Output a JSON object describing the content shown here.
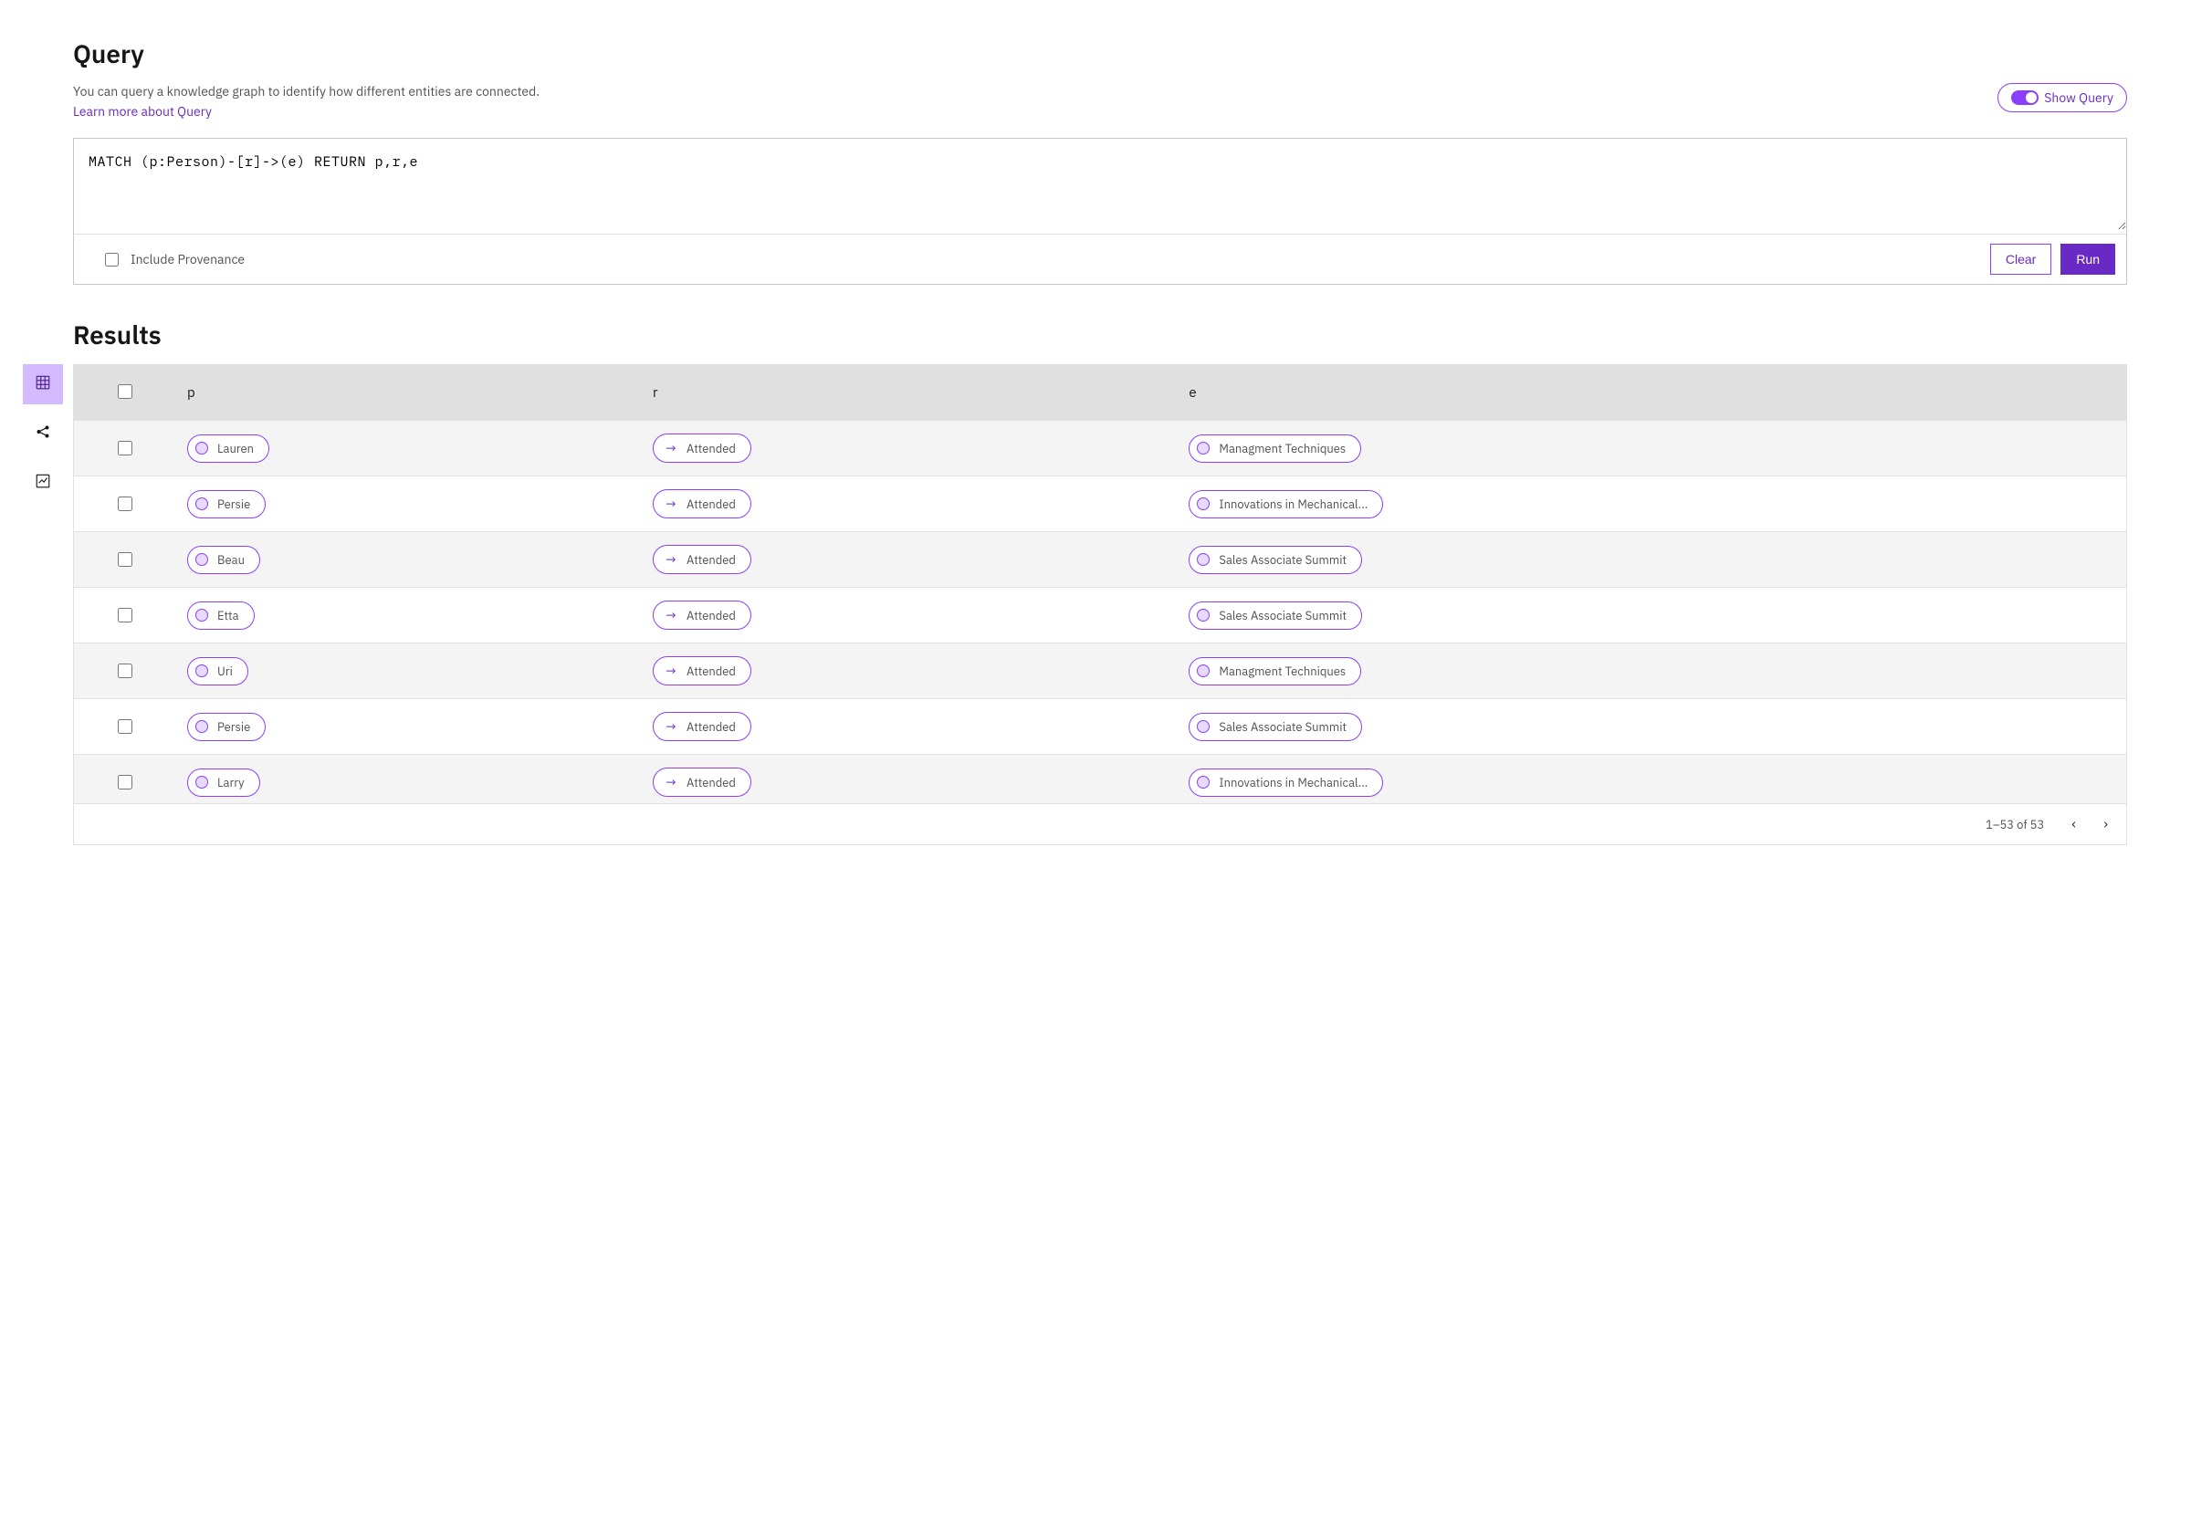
{
  "header": {
    "title": "Query",
    "desc": "You can query a knowledge graph to identify how different entities are connected.",
    "learn_more": "Learn more about Query",
    "show_query": "Show Query"
  },
  "query_box": {
    "text": "MATCH (p:Person)-[r]->(e) RETURN p,r,e",
    "include_provenance_label": "Include Provenance",
    "clear": "Clear",
    "run": "Run"
  },
  "results": {
    "title": "Results",
    "columns": {
      "p": "p",
      "r": "r",
      "e": "e"
    },
    "rows": [
      {
        "p": "Lauren",
        "r": "Attended",
        "e": "Managment Techniques"
      },
      {
        "p": "Persie",
        "r": "Attended",
        "e": "Innovations in Mechanical..."
      },
      {
        "p": "Beau",
        "r": "Attended",
        "e": "Sales Associate Summit"
      },
      {
        "p": "Etta",
        "r": "Attended",
        "e": "Sales Associate Summit"
      },
      {
        "p": "Uri",
        "r": "Attended",
        "e": "Managment Techniques"
      },
      {
        "p": "Persie",
        "r": "Attended",
        "e": "Sales Associate Summit"
      },
      {
        "p": "Larry",
        "r": "Attended",
        "e": "Innovations in Mechanical..."
      }
    ],
    "pager": {
      "range": "1–53 of 53"
    }
  }
}
